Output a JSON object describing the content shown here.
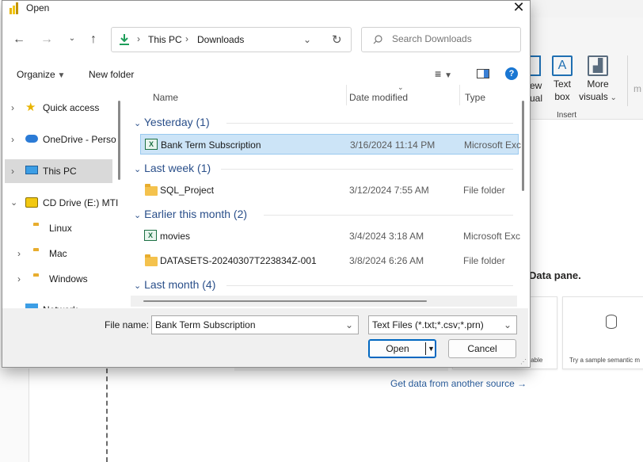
{
  "dialog": {
    "title": "Open",
    "close_icon": "close-icon",
    "address": {
      "segments": [
        "This PC",
        "Downloads"
      ],
      "separator": "›"
    },
    "search_placeholder": "Search Downloads",
    "toolbar": {
      "organize": "Organize",
      "new_folder": "New folder",
      "help_symbol": "?"
    },
    "sidebar": {
      "items": [
        {
          "label": "Quick access",
          "icon": "star-icon"
        },
        {
          "label": "OneDrive - Perso",
          "icon": "cloud-icon"
        },
        {
          "label": "This PC",
          "icon": "monitor-icon",
          "selected": true
        },
        {
          "label": "CD Drive (E:) MTI",
          "icon": "cd-drive-icon"
        },
        {
          "label": "Linux",
          "icon": "folder-icon"
        },
        {
          "label": "Mac",
          "icon": "folder-icon"
        },
        {
          "label": "Windows",
          "icon": "folder-icon"
        },
        {
          "label": "Network",
          "icon": "network-icon"
        }
      ]
    },
    "columns": {
      "name": "Name",
      "date": "Date modified",
      "type": "Type"
    },
    "groups": [
      {
        "label": "Yesterday (1)",
        "rows": [
          {
            "name": "Bank Term Subscription",
            "date": "3/16/2024 11:14 PM",
            "type": "Microsoft Exc",
            "icon": "excel-icon",
            "selected": true
          }
        ]
      },
      {
        "label": "Last week (1)",
        "rows": [
          {
            "name": "SQL_Project",
            "date": "3/12/2024 7:55 AM",
            "type": "File folder",
            "icon": "folder-icon"
          }
        ]
      },
      {
        "label": "Earlier this month (2)",
        "rows": [
          {
            "name": "movies",
            "date": "3/4/2024 3:18 AM",
            "type": "Microsoft Exc",
            "icon": "excel-icon"
          },
          {
            "name": "DATASETS-20240307T223834Z-001",
            "date": "3/8/2024 6:26 AM",
            "type": "File folder",
            "icon": "folder-icon"
          }
        ]
      },
      {
        "label": "Last month (4)",
        "rows": []
      }
    ],
    "file_name_label": "File name:",
    "file_name_value": "Bank Term Subscription",
    "file_type_value": "Text Files (*.txt;*.csv;*.prn)",
    "open_label": "Open",
    "cancel_label": "Cancel"
  },
  "background": {
    "ribbon": {
      "buttons": [
        {
          "line1": "ew",
          "line2": "ual"
        },
        {
          "line1": "Text",
          "line2": "box"
        },
        {
          "line1": "More",
          "line2": "visuals"
        },
        {
          "line1": "",
          "line2": "m"
        }
      ],
      "group_label": "Insert"
    },
    "data_pane_text": "Data pane.",
    "card_left_text": "table",
    "card_right_text": "Try a sample semantic m",
    "get_data_link": "Get data from another source →"
  }
}
